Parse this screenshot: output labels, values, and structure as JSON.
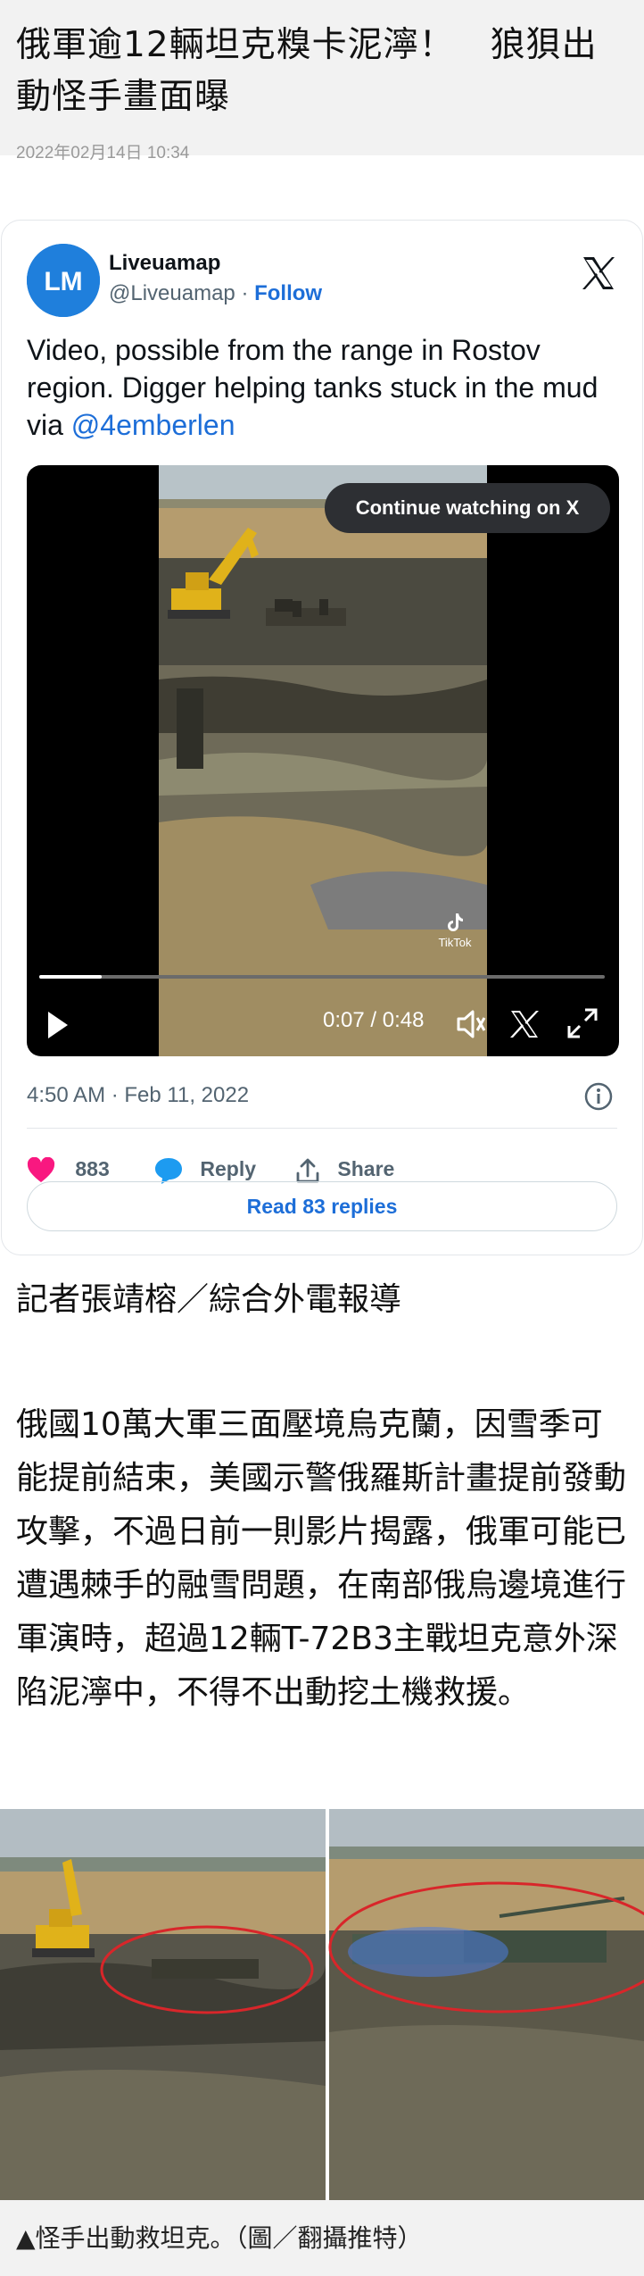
{
  "article": {
    "headline": "俄軍逾12輛坦克糗卡泥濘！　狼狽出動怪手畫面曝",
    "date": "2022年02月14日 10:34",
    "byline": "記者張靖榕／綜合外電報導",
    "body": "俄國10萬大軍三面壓境烏克蘭，因雪季可能提前結束，美國示警俄羅斯計畫提前發動攻擊，不過日前一則影片揭露，俄軍可能已遭遇棘手的融雪問題，在南部俄烏邊境進行軍演時，超過12輛T-72B3主戰坦克意外深陷泥濘中，不得不出動挖土機救援。",
    "photo_caption": "▲怪手出動救坦克。（圖／翻攝推特）"
  },
  "tweet": {
    "account_name": "Liveuamap",
    "handle": "@Liveuamap",
    "separator": " · ",
    "follow_label": "Follow",
    "text": "Video, possible from the range in Rostov region. Digger helping tanks stuck in the mud  via ",
    "mention": "@4emberlen",
    "video": {
      "continue_label": "Continue watching on X",
      "time": "0:07 / 0:48",
      "progress": 0.11,
      "watermark": "TikTok"
    },
    "timestamp": "4:50 AM · Feb 11, 2022",
    "likes": "883",
    "reply_label": "Reply",
    "share_label": "Share",
    "read_replies_label": "Read 83 replies"
  },
  "colors": {
    "accent": "#1d6ed8",
    "like": "#f91880",
    "avatar_bg": "#1f7fdc",
    "header_bg": "#f2f2f2"
  },
  "icons": [
    "x-logo-icon",
    "play-icon",
    "volume-icon",
    "expand-icon",
    "info-icon",
    "heart-icon",
    "reply-bubble-icon",
    "share-icon"
  ]
}
